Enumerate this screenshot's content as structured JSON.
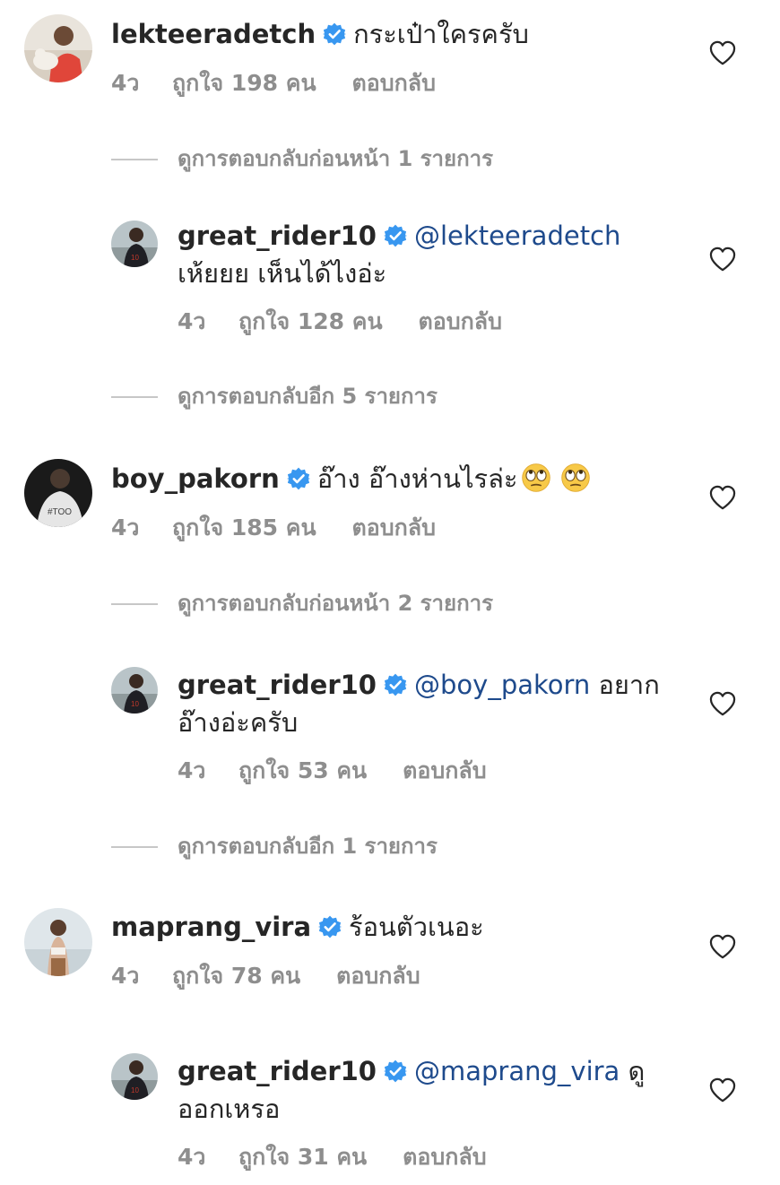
{
  "comments": [
    {
      "username": "lekteeradetch",
      "text": "กระเป๋าใครครับ",
      "time": "4ว",
      "likes": "ถูกใจ 198 คน",
      "reply": "ตอบกลับ"
    },
    {
      "username": "great_rider10",
      "mention": "@lekteeradetch",
      "text_rest": "",
      "text_line2": "เห้ยยย เห็นได้ไงอ่ะ",
      "time": "4ว",
      "likes": "ถูกใจ 128 คน",
      "reply": "ตอบกลับ"
    },
    {
      "username": "boy_pakorn",
      "text": "อ๊าง อ๊างห่านไรล่ะ",
      "time": "4ว",
      "likes": "ถูกใจ 185 คน",
      "reply": "ตอบกลับ"
    },
    {
      "username": "great_rider10",
      "mention": "@boy_pakorn",
      "text_rest": " อยาก",
      "text_line2": "อ๊างอ่ะครับ",
      "time": "4ว",
      "likes": "ถูกใจ 53 คน",
      "reply": "ตอบกลับ"
    },
    {
      "username": "maprang_vira",
      "text": "ร้อนตัวเนอะ",
      "time": "4ว",
      "likes": "ถูกใจ 78 คน",
      "reply": "ตอบกลับ"
    },
    {
      "username": "great_rider10",
      "mention": "@maprang_vira",
      "text_rest": " ดู",
      "text_line2": "ออกเหรอ",
      "time": "4ว",
      "likes": "ถูกใจ 31 คน",
      "reply": "ตอบกลับ"
    }
  ],
  "view_replies": [
    "ดูการตอบกลับก่อนหน้า 1 รายการ",
    "ดูการตอบกลับอีก 5 รายการ",
    "ดูการตอบกลับก่อนหน้า 2 รายการ",
    "ดูการตอบกลับอีก 1 รายการ"
  ],
  "icons": {
    "verified": "verified-badge-icon",
    "heart": "heart-outline-icon",
    "emoji": "face-with-rolling-eyes"
  },
  "colors": {
    "text": "#262626",
    "meta": "#8e8e8e",
    "mention": "#1e4a8c",
    "verified": "#3897f0"
  }
}
